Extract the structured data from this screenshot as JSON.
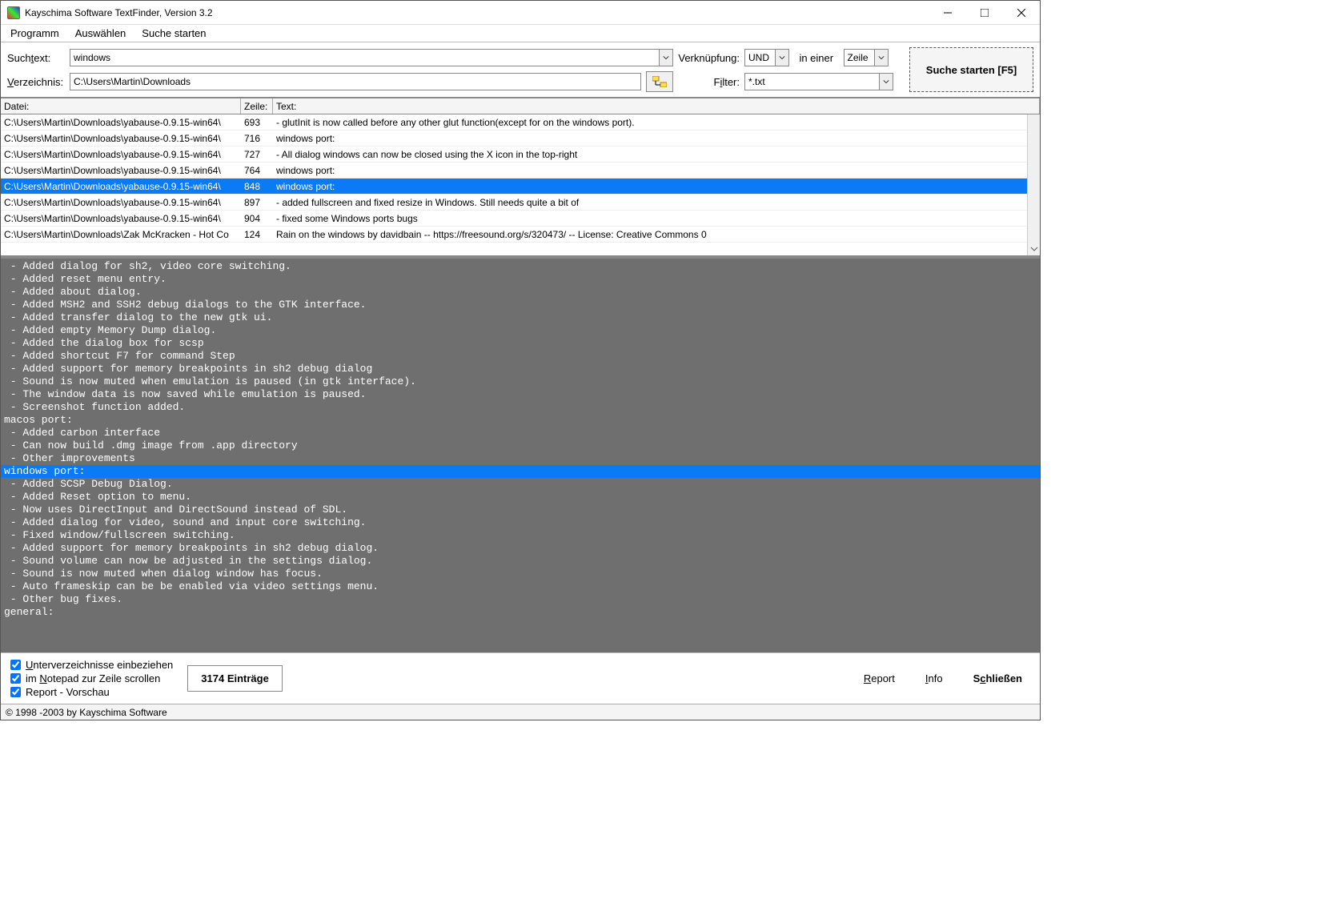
{
  "title": "Kayschima Software TextFinder, Version 3.2",
  "menu": {
    "programm": "Programm",
    "auswaehlen": "Auswählen",
    "suche": "Suche starten"
  },
  "labels": {
    "suchtext": "Suchtext:",
    "verzeichnis": "Verzeichnis:",
    "verknuepfung": "Verknüpfung:",
    "ineiner": "in einer",
    "filter": "Filter:"
  },
  "inputs": {
    "suchtext": "windows",
    "verzeichnis": "C:\\Users\\Martin\\Downloads",
    "verknuepfung": "UND",
    "ineiner": "Zeile",
    "filter": "*.txt"
  },
  "buttons": {
    "search": "Suche starten [F5]",
    "report": "Report",
    "info": "Info",
    "close": "Schließen"
  },
  "columns": {
    "datei": "Datei:",
    "zeile": "Zeile:",
    "text": "Text:"
  },
  "rows": [
    {
      "file": "C:\\Users\\Martin\\Downloads\\yabause-0.9.15-win64\\",
      "line": "693",
      "text": "    - glutInit is now called before any other glut function(except for on the windows port)."
    },
    {
      "file": "C:\\Users\\Martin\\Downloads\\yabause-0.9.15-win64\\",
      "line": "716",
      "text": "   windows port:"
    },
    {
      "file": "C:\\Users\\Martin\\Downloads\\yabause-0.9.15-win64\\",
      "line": "727",
      "text": "    - All dialog windows can now be closed using the X icon in the top-right"
    },
    {
      "file": "C:\\Users\\Martin\\Downloads\\yabause-0.9.15-win64\\",
      "line": "764",
      "text": "   windows port:"
    },
    {
      "file": "C:\\Users\\Martin\\Downloads\\yabause-0.9.15-win64\\",
      "line": "848",
      "text": "   windows port:",
      "selected": true
    },
    {
      "file": "C:\\Users\\Martin\\Downloads\\yabause-0.9.15-win64\\",
      "line": "897",
      "text": "    - added fullscreen and fixed resize in Windows. Still needs quite a bit of"
    },
    {
      "file": "C:\\Users\\Martin\\Downloads\\yabause-0.9.15-win64\\",
      "line": "904",
      "text": "    - fixed some Windows ports bugs"
    },
    {
      "file": "C:\\Users\\Martin\\Downloads\\Zak McKracken - Hot Co",
      "line": "124",
      "text": "Rain on the windows by davidbain -- https://freesound.org/s/320473/ -- License: Creative Commons 0"
    }
  ],
  "preview_lines": [
    " - Added dialog for sh2, video core switching.",
    " - Added reset menu entry.",
    " - Added about dialog.",
    " - Added MSH2 and SSH2 debug dialogs to the GTK interface.",
    " - Added transfer dialog to the new gtk ui.",
    " - Added empty Memory Dump dialog.",
    " - Added the dialog box for scsp",
    " - Added shortcut F7 for command Step",
    " - Added support for memory breakpoints in sh2 debug dialog",
    " - Sound is now muted when emulation is paused (in gtk interface).",
    " - The window data is now saved while emulation is paused.",
    " - Screenshot function added.",
    "macos port:",
    " - Added carbon interface",
    " - Can now build .dmg image from .app directory",
    " - Other improvements",
    "windows port:",
    " - Added SCSP Debug Dialog.",
    " - Added Reset option to menu.",
    " - Now uses DirectInput and DirectSound instead of SDL.",
    " - Added dialog for video, sound and input core switching.",
    " - Fixed window/fullscreen switching.",
    " - Added support for memory breakpoints in sh2 debug dialog.",
    " - Sound volume can now be adjusted in the settings dialog.",
    " - Sound is now muted when dialog window has focus.",
    " - Auto frameskip can be be enabled via video settings menu.",
    " - Other bug fixes.",
    "general:"
  ],
  "preview_highlight": 16,
  "checks": {
    "subdirs": "Unterverzeichnisse einbeziehen",
    "notepad": "im Notepad zur Zeile scrollen",
    "report": "Report - Vorschau"
  },
  "entries": "3174 Einträge",
  "status": "© 1998 -2003 by Kayschima Software"
}
